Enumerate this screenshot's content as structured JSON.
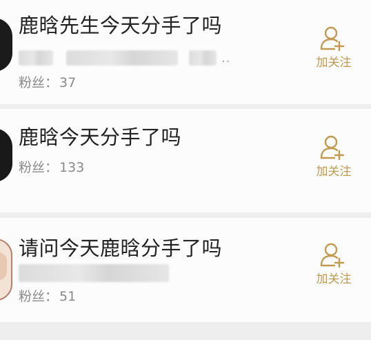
{
  "results": [
    {
      "title": "鹿晗先生今天分手了吗",
      "fans_label": "粉丝：",
      "fans_count": "37",
      "follow_label": "加关注",
      "blurred_suffix": ".."
    },
    {
      "title": "鹿晗今天分手了吗",
      "fans_label": "粉丝：",
      "fans_count": "133",
      "follow_label": "加关注"
    },
    {
      "title": "请问今天鹿晗分手了吗",
      "fans_label": "粉丝：",
      "fans_count": "51",
      "follow_label": "加关注"
    }
  ],
  "colors": {
    "accent": "#c39a4d",
    "title_text": "#222222",
    "secondary_text": "#8a8a8a",
    "card_bg": "#fcfcfc",
    "divider_bg": "#eeeeee"
  },
  "icons": {
    "follow": "add-user-icon"
  }
}
